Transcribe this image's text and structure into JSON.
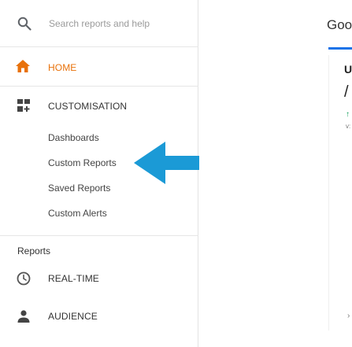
{
  "search": {
    "placeholder": "Search reports and help",
    "icon": "search-icon"
  },
  "nav": {
    "home": {
      "label": "HOME",
      "icon": "home-icon",
      "color": "#e8710a"
    },
    "customisation": {
      "label": "CUSTOMISATION",
      "icon": "dashboard-grid-icon",
      "items": [
        {
          "label": "Dashboards"
        },
        {
          "label": "Custom Reports"
        },
        {
          "label": "Saved Reports"
        },
        {
          "label": "Custom Alerts"
        }
      ]
    },
    "reports_heading": "Reports",
    "reports": [
      {
        "label": "REAL-TIME",
        "icon": "clock-icon"
      },
      {
        "label": "AUDIENCE",
        "icon": "person-icon"
      }
    ]
  },
  "main": {
    "title_fragment": "Goo",
    "card_letter": "U",
    "card_glyph": "/",
    "card_trend": "↑",
    "card_small": "v:",
    "card_chevron": "›",
    "accent": "#1a73e8"
  },
  "annotation": {
    "arrow_color": "#1b9ad6",
    "arrow_icon": "left-arrow-icon"
  }
}
